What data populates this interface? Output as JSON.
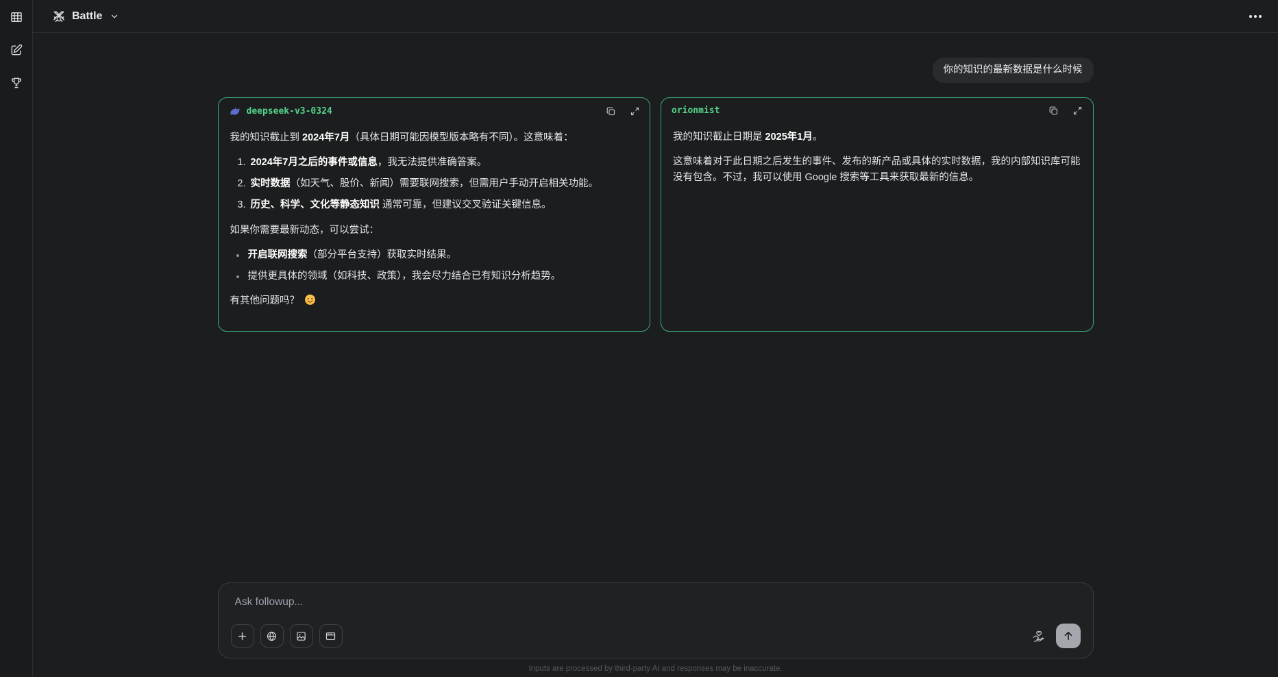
{
  "topbar": {
    "mode_label": "Battle",
    "mode_icon": "crossed-swords",
    "menu_icon": "ellipsis"
  },
  "sidebar": {
    "items": [
      {
        "icon": "grid-table"
      },
      {
        "icon": "new-chat-compose"
      },
      {
        "icon": "leaderboard-trophy"
      }
    ]
  },
  "conversation": {
    "user_message": "你的知识的最新数据是什么时候"
  },
  "panels": [
    {
      "model_name": "deepseek-v3-0324",
      "provider_icon": "deepseek-whale-icon",
      "actions": [
        "copy",
        "expand"
      ],
      "blocks": [
        {
          "type": "paragraph",
          "segments": [
            {
              "text": "我的知识截止到 "
            },
            {
              "text": "2024年7月",
              "bold": true
            },
            {
              "text": "（具体日期可能因模型版本略有不同）。这意味着："
            }
          ]
        },
        {
          "type": "ordered-list",
          "items": [
            [
              {
                "text": "2024年7月之后的事件或信息",
                "bold": true
              },
              {
                "text": "，我无法提供准确答案。"
              }
            ],
            [
              {
                "text": "实时数据",
                "bold": true
              },
              {
                "text": "（如天气、股价、新闻）需要联网搜索，但需用户手动开启相关功能。"
              }
            ],
            [
              {
                "text": "历史、科学、文化等静态知识",
                "bold": true
              },
              {
                "text": " 通常可靠，但建议交叉验证关键信息。"
              }
            ]
          ]
        },
        {
          "type": "paragraph",
          "segments": [
            {
              "text": "如果你需要最新动态，可以尝试："
            }
          ]
        },
        {
          "type": "bullet-list",
          "items": [
            [
              {
                "text": "开启联网搜索",
                "bold": true
              },
              {
                "text": "（部分平台支持）获取实时结果。"
              }
            ],
            [
              {
                "text": "提供更具体的领域（如科技、政策），我会尽力结合已有知识分析趋势。"
              }
            ]
          ]
        },
        {
          "type": "paragraph",
          "segments": [
            {
              "text": "有其他问题吗？ "
            },
            {
              "emoji": "smiling-face"
            }
          ]
        }
      ]
    },
    {
      "model_name": "orionmist",
      "provider_icon": null,
      "actions": [
        "copy",
        "expand"
      ],
      "blocks": [
        {
          "type": "paragraph",
          "segments": [
            {
              "text": "我的知识截止日期是 "
            },
            {
              "text": "2025年1月",
              "bold": true
            },
            {
              "text": "。"
            }
          ]
        },
        {
          "type": "paragraph",
          "segments": [
            {
              "text": "这意味着对于此日期之后发生的事件、发布的新产品或具体的实时数据，我的内部知识库可能没有包含。不过，我可以使用 Google 搜索等工具来获取最新的信息。"
            }
          ]
        }
      ]
    }
  ],
  "composer": {
    "placeholder": "Ask followup...",
    "buttons": [
      {
        "icon": "plus"
      },
      {
        "icon": "globe"
      },
      {
        "icon": "image"
      },
      {
        "icon": "browser-window"
      }
    ],
    "support_icon": "hand-heart",
    "send_icon": "arrow-up"
  },
  "footer": {
    "disclaimer": "Inputs are processed by third-party AI and responses may be inaccurate."
  },
  "colors": {
    "background": "#1c1d1e",
    "panel_border": "#3daa7d",
    "model_name_green": "#55d38c",
    "user_bubble": "#2a2b2d",
    "whale_blue": "#5d6cc9",
    "send_button": "#a4a8ac"
  }
}
